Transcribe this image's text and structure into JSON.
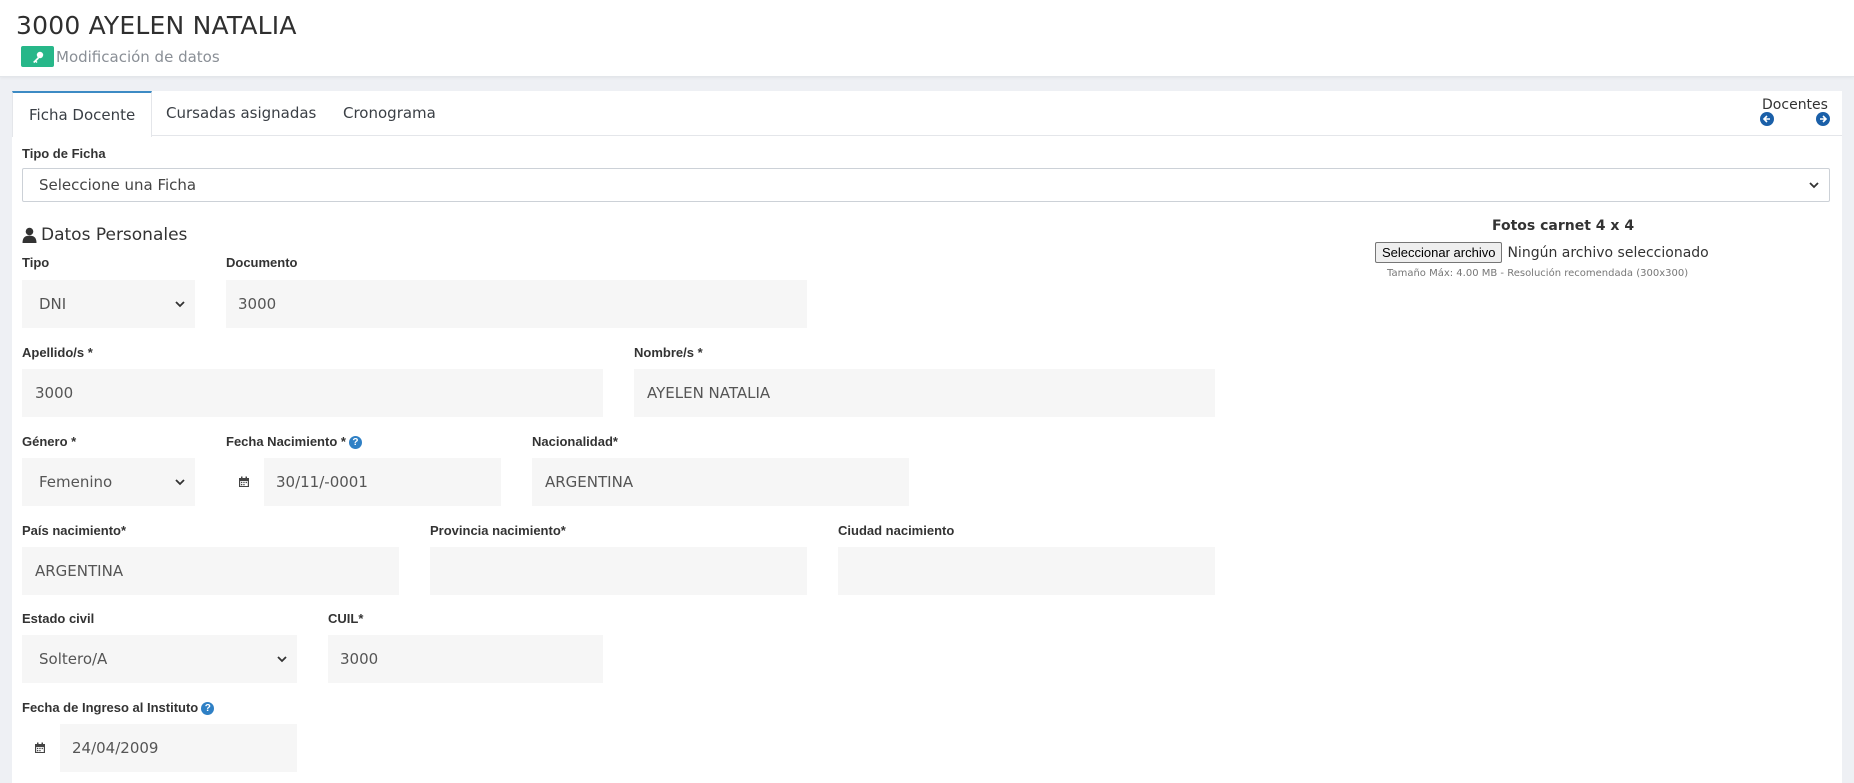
{
  "header": {
    "title": "3000 AYELEN NATALIA",
    "subtitle": "Modificación de datos",
    "badge_icon": "key-icon",
    "badge_color": "#27b789"
  },
  "tabs": [
    {
      "label": "Ficha Docente",
      "active": true
    },
    {
      "label": "Cursadas asignadas",
      "active": false
    },
    {
      "label": "Cronograma",
      "active": false
    }
  ],
  "nav": {
    "label": "Docentes",
    "prev_icon": "arrow-left-circle-icon",
    "next_icon": "arrow-right-circle-icon"
  },
  "ficha": {
    "label": "Tipo de Ficha",
    "value": "Seleccione una Ficha"
  },
  "personal": {
    "section_title": "Datos Personales",
    "section_icon": "user-icon",
    "tipo": {
      "label": "Tipo",
      "value": "DNI"
    },
    "documento": {
      "label": "Documento",
      "value": "3000"
    },
    "apellido": {
      "label": "Apellido/s *",
      "value": "3000"
    },
    "nombre": {
      "label": "Nombre/s *",
      "value": "AYELEN NATALIA"
    },
    "genero": {
      "label": "Género *",
      "value": "Femenino"
    },
    "fecha_nac": {
      "label": "Fecha Nacimiento *",
      "value": "30/11/-0001"
    },
    "nacionalidad": {
      "label": "Nacionalidad*",
      "value": "ARGENTINA"
    },
    "pais": {
      "label": "País nacimiento*",
      "value": "ARGENTINA"
    },
    "provincia": {
      "label": "Provincia nacimiento*",
      "value": ""
    },
    "ciudad": {
      "label": "Ciudad nacimiento",
      "value": ""
    },
    "estado_civil": {
      "label": "Estado civil",
      "value": "Soltero/A"
    },
    "cuil": {
      "label": "CUIL*",
      "value": "3000"
    },
    "fecha_ingreso": {
      "label": "Fecha de Ingreso al Instituto",
      "value": "24/04/2009"
    }
  },
  "photo": {
    "title": "Fotos carnet 4 x 4",
    "button": "Seleccionar archivo",
    "status": "Ningún archivo seleccionado",
    "note": "Tamaño Máx: 4.00 MB - Resolución recomendada (300x300)"
  },
  "help_mark": "?",
  "colors": {
    "accent": "#3d8bc4",
    "field_bg": "#f6f6f6",
    "help": "#2f80c5",
    "nav_arrow": "#1a5fa8"
  }
}
